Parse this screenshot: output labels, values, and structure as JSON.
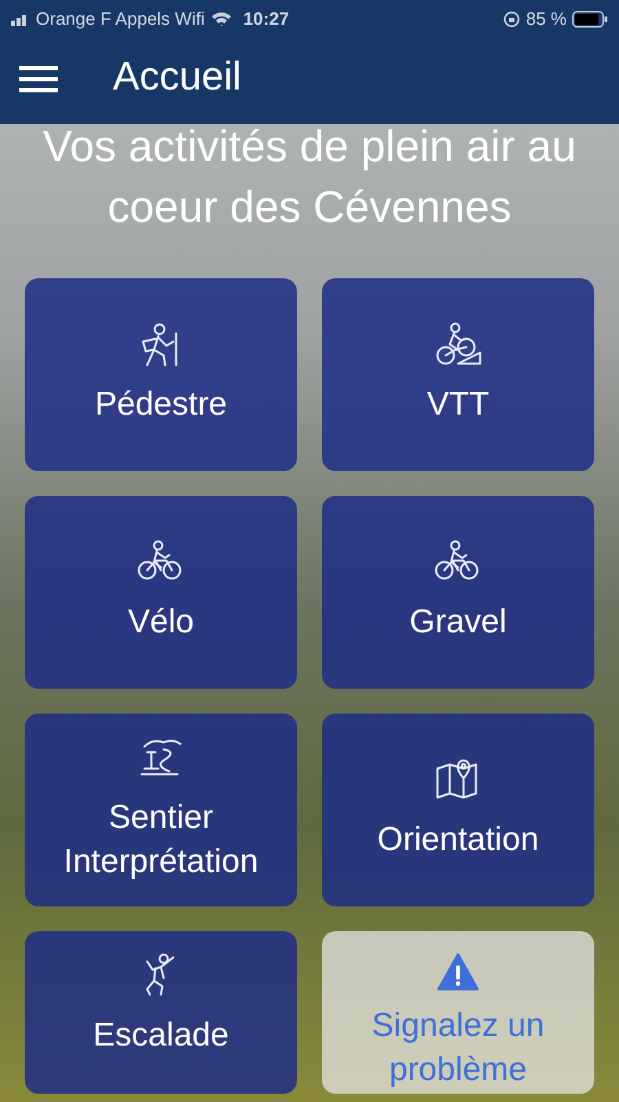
{
  "status_bar": {
    "carrier": "Orange F Appels Wifi",
    "time": "10:27",
    "battery": "85 %"
  },
  "header": {
    "title": "Accueil"
  },
  "headline": "Vos activités de plein air au coeur des Cévennes",
  "tiles": [
    {
      "kind": "activity",
      "label": "Pédestre"
    },
    {
      "kind": "activity",
      "label": "VTT"
    },
    {
      "kind": "activity",
      "label": "Vélo"
    },
    {
      "kind": "activity",
      "label": "Gravel"
    },
    {
      "kind": "activity",
      "label": "Sentier Interprétation"
    },
    {
      "kind": "activity",
      "label": "Orientation"
    },
    {
      "kind": "activity",
      "label": "Escalade"
    },
    {
      "kind": "report",
      "label": "Signalez un problème"
    }
  ]
}
